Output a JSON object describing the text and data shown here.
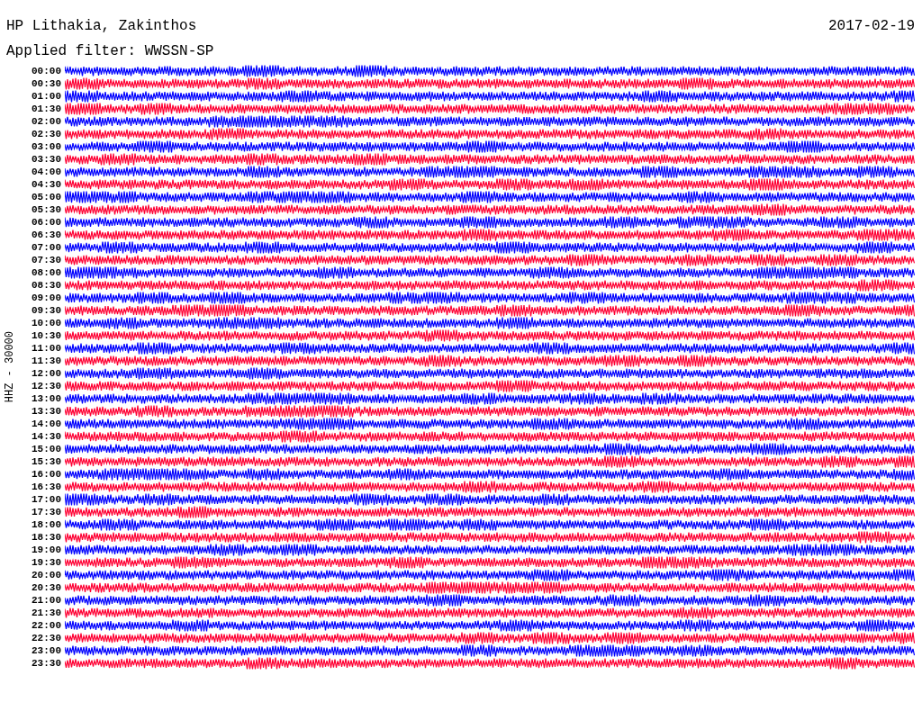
{
  "header": {
    "station": "HP Lithakia, Zakinthos",
    "date": "2017-02-19",
    "filter": "Applied filter: WWSSN-SP"
  },
  "plot": {
    "channel_label": "HHZ - 30000",
    "rows": [
      {
        "time": "00:00",
        "color": "#0000ff"
      },
      {
        "time": "00:30",
        "color": "#ff0033"
      },
      {
        "time": "01:00",
        "color": "#0000ff"
      },
      {
        "time": "01:30",
        "color": "#ff0033"
      },
      {
        "time": "02:00",
        "color": "#0000ff"
      },
      {
        "time": "02:30",
        "color": "#ff0033"
      },
      {
        "time": "03:00",
        "color": "#0000ff"
      },
      {
        "time": "03:30",
        "color": "#ff0033"
      },
      {
        "time": "04:00",
        "color": "#0000ff"
      },
      {
        "time": "04:30",
        "color": "#ff0033"
      },
      {
        "time": "05:00",
        "color": "#0000ff"
      },
      {
        "time": "05:30",
        "color": "#ff0033"
      },
      {
        "time": "06:00",
        "color": "#0000ff"
      },
      {
        "time": "06:30",
        "color": "#ff0033"
      },
      {
        "time": "07:00",
        "color": "#0000ff"
      },
      {
        "time": "07:30",
        "color": "#ff0033"
      },
      {
        "time": "08:00",
        "color": "#0000ff"
      },
      {
        "time": "08:30",
        "color": "#ff0033"
      },
      {
        "time": "09:00",
        "color": "#0000ff"
      },
      {
        "time": "09:30",
        "color": "#ff0033"
      },
      {
        "time": "10:00",
        "color": "#0000ff"
      },
      {
        "time": "10:30",
        "color": "#ff0033"
      },
      {
        "time": "11:00",
        "color": "#0000ff"
      },
      {
        "time": "11:30",
        "color": "#ff0033"
      },
      {
        "time": "12:00",
        "color": "#0000ff"
      },
      {
        "time": "12:30",
        "color": "#ff0033"
      },
      {
        "time": "13:00",
        "color": "#0000ff"
      },
      {
        "time": "13:30",
        "color": "#ff0033"
      },
      {
        "time": "14:00",
        "color": "#0000ff"
      },
      {
        "time": "14:30",
        "color": "#ff0033"
      },
      {
        "time": "15:00",
        "color": "#0000ff"
      },
      {
        "time": "15:30",
        "color": "#ff0033"
      },
      {
        "time": "16:00",
        "color": "#0000ff"
      },
      {
        "time": "16:30",
        "color": "#ff0033"
      },
      {
        "time": "17:00",
        "color": "#0000ff"
      },
      {
        "time": "17:30",
        "color": "#ff0033"
      },
      {
        "time": "18:00",
        "color": "#0000ff"
      },
      {
        "time": "18:30",
        "color": "#ff0033"
      },
      {
        "time": "19:00",
        "color": "#0000ff"
      },
      {
        "time": "19:30",
        "color": "#ff0033"
      },
      {
        "time": "20:00",
        "color": "#0000ff"
      },
      {
        "time": "20:30",
        "color": "#ff0033"
      },
      {
        "time": "21:00",
        "color": "#0000ff"
      },
      {
        "time": "21:30",
        "color": "#ff0033"
      },
      {
        "time": "22:00",
        "color": "#0000ff"
      },
      {
        "time": "22:30",
        "color": "#ff0033"
      },
      {
        "time": "23:00",
        "color": "#0000ff"
      },
      {
        "time": "23:30",
        "color": "#ff0033"
      }
    ]
  }
}
